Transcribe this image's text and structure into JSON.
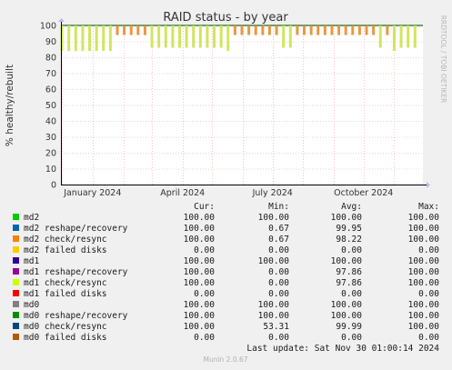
{
  "chart_data": {
    "type": "area",
    "title": "RAID status - by year",
    "ylabel": "% healthy/rebuilt",
    "side_label": "RRDTOOL / TOBI OETIKER",
    "ylim": [
      0,
      100
    ],
    "yticks": [
      0,
      10,
      20,
      30,
      40,
      50,
      60,
      70,
      80,
      90,
      100
    ],
    "x_date_range": [
      "2023-11-30",
      "2024-11-30"
    ],
    "month_labels": [
      {
        "date": "2024-01-01",
        "label": "January 2024"
      },
      {
        "date": "2024-04-01",
        "label": "April 2024"
      },
      {
        "date": "2024-07-01",
        "label": "July 2024"
      },
      {
        "date": "2024-10-01",
        "label": "October 2024"
      }
    ],
    "monthly_grid": [
      "2023-12-01",
      "2024-01-01",
      "2024-02-01",
      "2024-03-01",
      "2024-04-01",
      "2024-05-01",
      "2024-06-01",
      "2024-07-01",
      "2024-08-01",
      "2024-09-01",
      "2024-10-01",
      "2024-11-01"
    ],
    "dips": [
      {
        "date": "2023-12-01",
        "min": 84
      },
      {
        "date": "2023-12-08",
        "min": 84
      },
      {
        "date": "2023-12-15",
        "min": 84
      },
      {
        "date": "2023-12-22",
        "min": 84
      },
      {
        "date": "2023-12-29",
        "min": 84
      },
      {
        "date": "2024-01-05",
        "min": 84
      },
      {
        "date": "2024-01-12",
        "min": 84
      },
      {
        "date": "2024-01-19",
        "min": 84
      },
      {
        "date": "2024-01-26",
        "min": 94
      },
      {
        "date": "2024-02-02",
        "min": 94
      },
      {
        "date": "2024-02-09",
        "min": 94
      },
      {
        "date": "2024-02-16",
        "min": 94
      },
      {
        "date": "2024-02-23",
        "min": 94
      },
      {
        "date": "2024-03-01",
        "min": 86
      },
      {
        "date": "2024-03-08",
        "min": 86
      },
      {
        "date": "2024-03-15",
        "min": 86
      },
      {
        "date": "2024-03-22",
        "min": 86
      },
      {
        "date": "2024-03-29",
        "min": 86
      },
      {
        "date": "2024-04-05",
        "min": 86
      },
      {
        "date": "2024-04-12",
        "min": 86
      },
      {
        "date": "2024-04-19",
        "min": 86
      },
      {
        "date": "2024-04-26",
        "min": 86
      },
      {
        "date": "2024-05-03",
        "min": 86
      },
      {
        "date": "2024-05-10",
        "min": 86
      },
      {
        "date": "2024-05-17",
        "min": 84
      },
      {
        "date": "2024-05-24",
        "min": 94
      },
      {
        "date": "2024-05-31",
        "min": 94
      },
      {
        "date": "2024-06-07",
        "min": 94
      },
      {
        "date": "2024-06-14",
        "min": 94
      },
      {
        "date": "2024-06-21",
        "min": 94
      },
      {
        "date": "2024-06-28",
        "min": 94
      },
      {
        "date": "2024-07-05",
        "min": 94
      },
      {
        "date": "2024-07-12",
        "min": 86
      },
      {
        "date": "2024-07-19",
        "min": 86
      },
      {
        "date": "2024-07-26",
        "min": 94
      },
      {
        "date": "2024-08-02",
        "min": 94
      },
      {
        "date": "2024-08-09",
        "min": 94
      },
      {
        "date": "2024-08-16",
        "min": 94
      },
      {
        "date": "2024-08-23",
        "min": 94
      },
      {
        "date": "2024-08-30",
        "min": 94
      },
      {
        "date": "2024-09-06",
        "min": 94
      },
      {
        "date": "2024-09-13",
        "min": 94
      },
      {
        "date": "2024-09-20",
        "min": 94
      },
      {
        "date": "2024-09-27",
        "min": 94
      },
      {
        "date": "2024-10-04",
        "min": 94
      },
      {
        "date": "2024-10-11",
        "min": 94
      },
      {
        "date": "2024-10-18",
        "min": 86
      },
      {
        "date": "2024-10-25",
        "min": 94
      },
      {
        "date": "2024-11-01",
        "min": 84
      },
      {
        "date": "2024-11-08",
        "min": 86
      },
      {
        "date": "2024-11-15",
        "min": 86
      },
      {
        "date": "2024-11-22",
        "min": 86
      }
    ],
    "colors": {
      "fill": "#cce24c",
      "dip_alt": "#e88c2c",
      "top_line": "#1f6b1f",
      "grid": "#e8a0a0",
      "arrow": "#b8b8e8"
    }
  },
  "legend": {
    "headers": [
      "Cur:",
      "Min:",
      "Avg:",
      "Max:"
    ],
    "rows": [
      {
        "name": "md2",
        "color": "#00cc00",
        "cur": "100.00",
        "min": "100.00",
        "avg": "100.00",
        "max": "100.00"
      },
      {
        "name": "md2 reshape/recovery",
        "color": "#0066b3",
        "cur": "100.00",
        "min": "0.67",
        "avg": "99.95",
        "max": "100.00"
      },
      {
        "name": "md2 check/resync",
        "color": "#ff8000",
        "cur": "100.00",
        "min": "0.67",
        "avg": "98.22",
        "max": "100.00"
      },
      {
        "name": "md2 failed disks",
        "color": "#ffcc00",
        "cur": "0.00",
        "min": "0.00",
        "avg": "0.00",
        "max": "0.00"
      },
      {
        "name": "md1",
        "color": "#330099",
        "cur": "100.00",
        "min": "100.00",
        "avg": "100.00",
        "max": "100.00"
      },
      {
        "name": "md1 reshape/recovery",
        "color": "#990099",
        "cur": "100.00",
        "min": "0.00",
        "avg": "97.86",
        "max": "100.00"
      },
      {
        "name": "md1 check/resync",
        "color": "#ccff00",
        "cur": "100.00",
        "min": "0.00",
        "avg": "97.86",
        "max": "100.00"
      },
      {
        "name": "md1 failed disks",
        "color": "#ff0000",
        "cur": "0.00",
        "min": "0.00",
        "avg": "0.00",
        "max": "0.00"
      },
      {
        "name": "md0",
        "color": "#808080",
        "cur": "100.00",
        "min": "100.00",
        "avg": "100.00",
        "max": "100.00"
      },
      {
        "name": "md0 reshape/recovery",
        "color": "#008f00",
        "cur": "100.00",
        "min": "100.00",
        "avg": "100.00",
        "max": "100.00"
      },
      {
        "name": "md0 check/resync",
        "color": "#00487d",
        "cur": "100.00",
        "min": "53.31",
        "avg": "99.99",
        "max": "100.00"
      },
      {
        "name": "md0 failed disks",
        "color": "#b35a00",
        "cur": "0.00",
        "min": "0.00",
        "avg": "0.00",
        "max": "0.00"
      }
    ],
    "last_update": "Last update: Sat Nov 30 01:00:14 2024"
  },
  "footer": "Munin 2.0.67"
}
